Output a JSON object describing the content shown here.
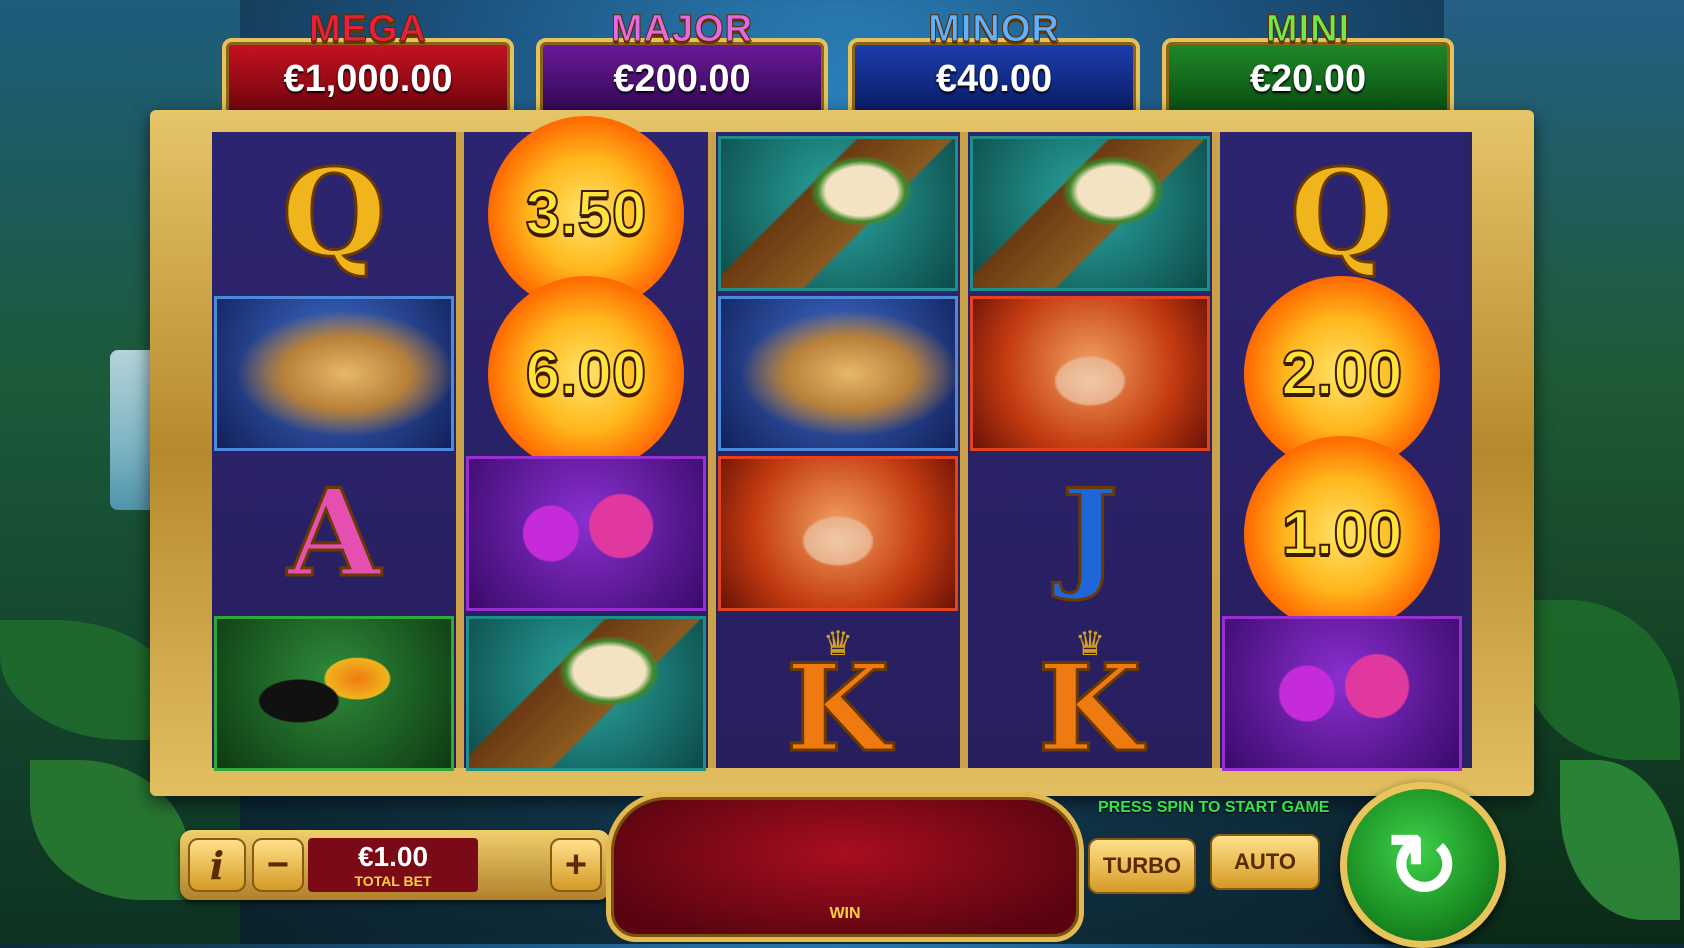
{
  "jackpots": [
    {
      "title": "MEGA",
      "value": "€1,000.00",
      "title_color": "#e8203a",
      "box_color": "#8a0610"
    },
    {
      "title": "MAJOR",
      "value": "€200.00",
      "title_color": "#d94ad6",
      "box_color": "#3b0b5a"
    },
    {
      "title": "MINOR",
      "value": "€40.00",
      "title_color": "#49a7ff",
      "box_color": "#0b1f6a"
    },
    {
      "title": "MINI",
      "value": "€20.00",
      "title_color": "#5bdc3c",
      "box_color": "#0d5a16"
    }
  ],
  "reels": [
    {
      "symbols": [
        {
          "type": "letter",
          "name": "q-symbol",
          "text": "Q",
          "color": "#f0b41c"
        },
        {
          "type": "jaguar",
          "name": "jaguar-symbol",
          "frame": "#4a8adb"
        },
        {
          "type": "letter",
          "name": "a-symbol",
          "text": "A",
          "color": "#e54fb0"
        },
        {
          "type": "toucan",
          "name": "toucan-symbol",
          "frame": "#2ea93a"
        }
      ]
    },
    {
      "symbols": [
        {
          "type": "fireball",
          "name": "fireball-symbol",
          "text": "3.50"
        },
        {
          "type": "fireball",
          "name": "fireball-symbol",
          "text": "6.00"
        },
        {
          "type": "orchid",
          "name": "orchid-symbol",
          "frame": "#9a2fd1"
        },
        {
          "type": "drum",
          "name": "drum-symbol",
          "frame": "#1d8f8a"
        }
      ]
    },
    {
      "symbols": [
        {
          "type": "drum",
          "name": "drum-symbol",
          "frame": "#1d8f8a"
        },
        {
          "type": "jaguar",
          "name": "jaguar-symbol",
          "frame": "#4a8adb"
        },
        {
          "type": "woman",
          "name": "fire-woman-symbol",
          "frame": "#e2421c"
        },
        {
          "type": "letter",
          "name": "k-symbol",
          "text": "K",
          "color": "#f07a12",
          "crown": true
        }
      ]
    },
    {
      "symbols": [
        {
          "type": "drum",
          "name": "drum-symbol",
          "frame": "#1d8f8a"
        },
        {
          "type": "woman",
          "name": "fire-woman-symbol",
          "frame": "#e2421c"
        },
        {
          "type": "letter",
          "name": "j-symbol",
          "text": "J",
          "color": "#1f67d8"
        },
        {
          "type": "letter",
          "name": "k-symbol",
          "text": "K",
          "color": "#f07a12",
          "crown": true
        }
      ]
    },
    {
      "symbols": [
        {
          "type": "letter",
          "name": "q-symbol",
          "text": "Q",
          "color": "#f0b41c"
        },
        {
          "type": "fireball",
          "name": "fireball-symbol",
          "text": "2.00"
        },
        {
          "type": "fireball",
          "name": "fireball-symbol",
          "text": "1.00"
        },
        {
          "type": "orchid",
          "name": "orchid-symbol",
          "frame": "#9a2fd1"
        }
      ]
    }
  ],
  "controls": {
    "info_label": "i",
    "minus_label": "−",
    "plus_label": "+",
    "bet_value": "€1.00",
    "bet_caption": "TOTAL BET",
    "win_label": "WIN",
    "hint": "PRESS SPIN TO START GAME",
    "turbo_label": "TURBO",
    "auto_label": "AUTO",
    "spin_icon": "↻"
  }
}
